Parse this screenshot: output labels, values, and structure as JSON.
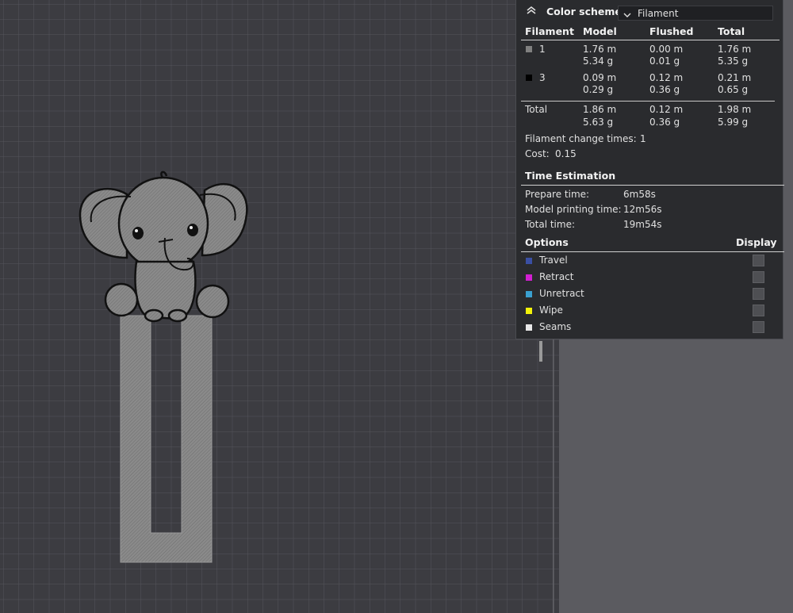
{
  "color_scheme": {
    "label": "Color scheme",
    "selected": "Filament"
  },
  "filament_table": {
    "headers": [
      "Filament",
      "Model",
      "Flushed",
      "Total"
    ],
    "rows": [
      {
        "id": "1",
        "swatch": "#808080",
        "model": [
          "1.76 m",
          "5.34 g"
        ],
        "flushed": [
          "0.00 m",
          "0.01 g"
        ],
        "total": [
          "1.76 m",
          "5.35 g"
        ]
      },
      {
        "id": "3",
        "swatch": "#000000",
        "model": [
          "0.09 m",
          "0.29 g"
        ],
        "flushed": [
          "0.12 m",
          "0.36 g"
        ],
        "total": [
          "0.21 m",
          "0.65 g"
        ]
      }
    ],
    "totals": {
      "label": "Total",
      "model": [
        "1.86 m",
        "5.63 g"
      ],
      "flushed": [
        "0.12 m",
        "0.36 g"
      ],
      "total": [
        "1.98 m",
        "5.99 g"
      ]
    }
  },
  "change_times": {
    "label": "Filament change times:",
    "value": "1"
  },
  "cost": {
    "label": "Cost:",
    "value": "0.15"
  },
  "time_estimation": {
    "title": "Time Estimation",
    "rows": [
      {
        "label": "Prepare time:",
        "value": "6m58s"
      },
      {
        "label": "Model printing time:",
        "value": "12m56s"
      },
      {
        "label": "Total time:",
        "value": "19m54s"
      }
    ]
  },
  "options": {
    "title": "Options",
    "display_label": "Display",
    "items": [
      {
        "label": "Travel",
        "color": "#3a4fa3"
      },
      {
        "label": "Retract",
        "color": "#d21fd2"
      },
      {
        "label": "Unretract",
        "color": "#3aa0d0"
      },
      {
        "label": "Wipe",
        "color": "#f2f20a"
      },
      {
        "label": "Seams",
        "color": "#e8e8e8"
      }
    ]
  },
  "colors": {
    "plate": "#3c3c41",
    "grid_line": "#55555b",
    "panel_bg": "#2a2b2e",
    "model_fill": "#858585"
  }
}
